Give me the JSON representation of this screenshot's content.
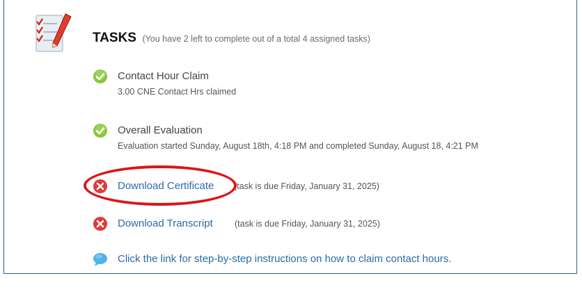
{
  "header": {
    "title": "TASKS",
    "summary": "(You have 2 left to complete out of a total 4 assigned tasks)"
  },
  "tasks": [
    {
      "status": "complete",
      "icon": "check-icon",
      "title": "Contact Hour Claim",
      "detail": "3.00 CNE Contact Hrs claimed"
    },
    {
      "status": "complete",
      "icon": "check-icon",
      "title": "Overall Evaluation",
      "detail": "Evaluation started Sunday, August 18th, 4:18 PM and completed Sunday, August 18, 4:21 PM"
    },
    {
      "status": "incomplete",
      "icon": "x-icon",
      "title": "Download Certificate",
      "note": "(task is due Friday, January 31, 2025)"
    },
    {
      "status": "incomplete",
      "icon": "x-icon",
      "title": "Download Transcript",
      "note": "(task is due Friday, January 31, 2025)"
    }
  ],
  "help": {
    "icon": "speech-bubble-icon",
    "link_text": "Click the link for step-by-step instructions on how to claim contact hours."
  },
  "colors": {
    "link": "#2a6aa8",
    "check_green": "#8cc63f",
    "x_red": "#e03a3a",
    "highlight_red": "#d9161b",
    "border": "#2f5c8f"
  }
}
